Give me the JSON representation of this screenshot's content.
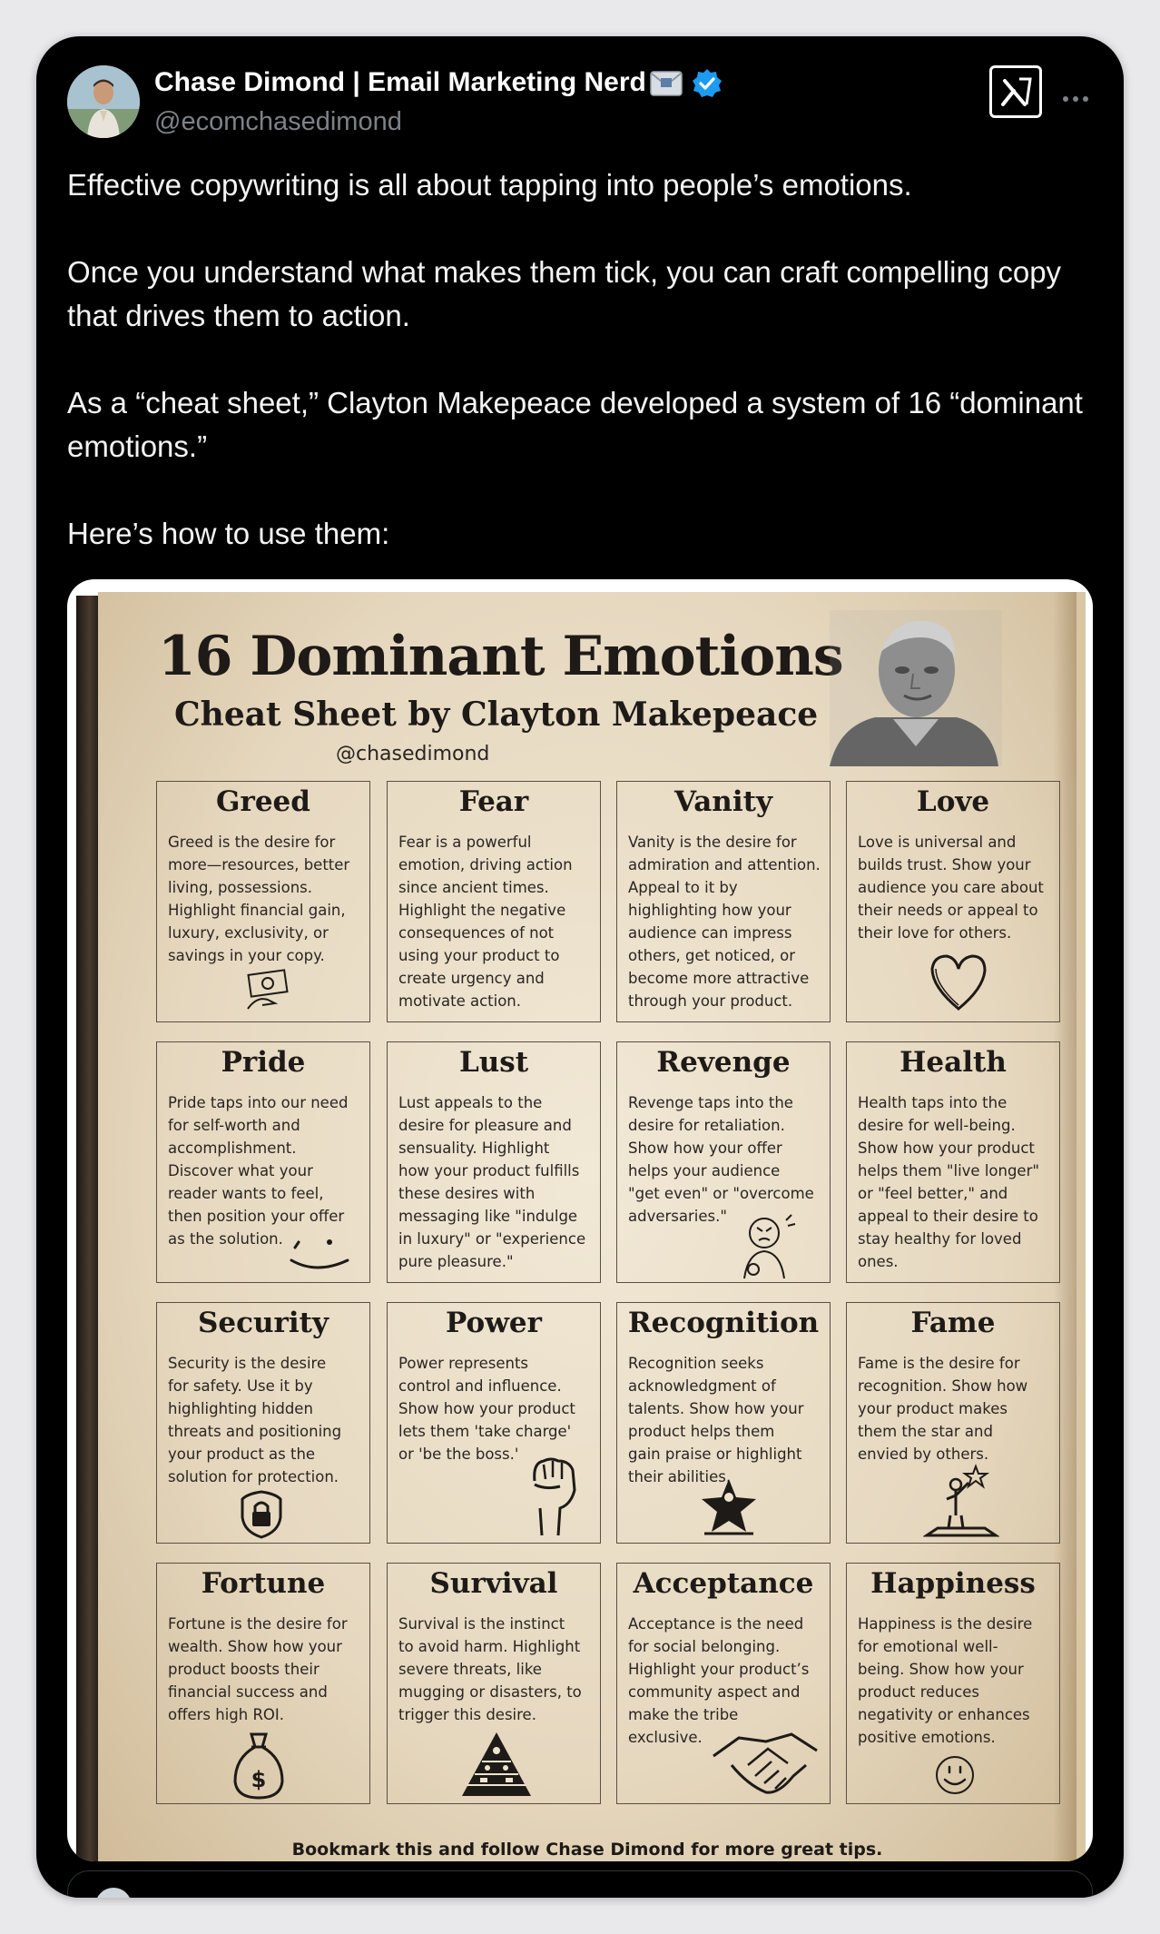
{
  "author": {
    "name": "Chase Dimond | Email Marketing Nerd",
    "handle": "@ecomchasedimond"
  },
  "tweet": {
    "paragraphs": [
      "Effective copywriting is all about tapping into people’s emotions.",
      "Once you understand what makes them tick, you can craft compelling copy that drives them to action.",
      "As a “cheat sheet,” Clayton Makepeace developed a system of 16 “dominant emotions.”",
      "Here’s how to use them:"
    ]
  },
  "infographic": {
    "title": "16 Dominant Emotions",
    "subtitle": "Cheat Sheet by Clayton Makepeace",
    "handle": "@chasedimond",
    "footer": "Bookmark this and follow Chase Dimond for more great tips.",
    "emotions": [
      {
        "title": "Greed",
        "icon": "money-hand-icon",
        "desc": "Greed is the desire for\nmore—resources, better\nliving, possessions.\nHighlight financial gain,\nluxury, exclusivity, or\nsavings in your copy."
      },
      {
        "title": "Fear",
        "icon": "",
        "desc": "Fear is a powerful\nemotion, driving action\nsince ancient times.\nHighlight the negative\nconsequences of not\nusing your product to\ncreate urgency and\nmotivate action."
      },
      {
        "title": "Vanity",
        "icon": "",
        "desc": "Vanity is the desire for\nadmiration and attention.\nAppeal to it by\nhighlighting how your\naudience can impress\nothers, get noticed, or\nbecome more attractive\nthrough your product."
      },
      {
        "title": "Love",
        "icon": "heart-icon",
        "desc": "Love is universal and\nbuilds trust. Show your\naudience you care about\ntheir needs or appeal to\ntheir love for others."
      },
      {
        "title": "Pride",
        "icon": "smile-icon",
        "desc": "Pride taps into our need\nfor self-worth and\naccomplishment.\nDiscover what your\nreader wants to feel,\nthen position your offer\nas the solution."
      },
      {
        "title": "Lust",
        "icon": "",
        "desc": "Lust appeals to the\ndesire for pleasure and\nsensuality. Highlight\nhow your product fulfills\nthese desires with\nmessaging like \"indulge\nin luxury\" or \"experience\npure pleasure.\""
      },
      {
        "title": "Revenge",
        "icon": "angry-person-icon",
        "desc": "Revenge taps into the\ndesire for retaliation.\nShow how your offer\nhelps your audience\n\"get even\" or \"overcome\nadversaries.\""
      },
      {
        "title": "Health",
        "icon": "",
        "desc": "Health taps into the\ndesire for well-being.\nShow how your product\nhelps them \"live longer\"\nor \"feel better,\" and\nappeal to their desire to\nstay healthy for loved\nones."
      },
      {
        "title": "Security",
        "icon": "lock-shield-icon",
        "desc": "Security is the desire\nfor safety. Use it by\nhighlighting hidden\nthreats and positioning\nyour product as the\nsolution for protection."
      },
      {
        "title": "Power",
        "icon": "raised-fist-icon",
        "desc": "Power represents\ncontrol and influence.\nShow how your product\nlets them 'take charge'\nor 'be the boss.'"
      },
      {
        "title": "Recognition",
        "icon": "star-person-icon",
        "desc": "Recognition seeks\nacknowledgment of\ntalents. Show how your\nproduct helps them\ngain praise or highlight\ntheir abilities."
      },
      {
        "title": "Fame",
        "icon": "podium-star-icon",
        "desc": "Fame is the desire for\nrecognition. Show how\nyour product makes\nthem the star and\nenvied by others."
      },
      {
        "title": "Fortune",
        "icon": "money-bag-icon",
        "desc": "Fortune is the desire for\nwealth. Show how your\nproduct boosts their\nfinancial success and\noffers high ROI."
      },
      {
        "title": "Survival",
        "icon": "pyramid-icon",
        "desc": "Survival is the instinct\nto avoid harm. Highlight\nsevere threats, like\nmugging or disasters, to\ntrigger this desire."
      },
      {
        "title": "Acceptance",
        "icon": "handshake-icon",
        "desc": "Acceptance is the need\nfor social belonging.\nHighlight your product’s\ncommunity aspect and\nmake the tribe\nexclusive."
      },
      {
        "title": "Happiness",
        "icon": "smiley-face-icon",
        "desc": "Happiness is the desire\nfor emotional well-\nbeing. Show how your\nproduct reduces\nnegativity or enhances\npositive emotions."
      }
    ]
  },
  "colors": {
    "card_bg": "#000000",
    "text": "#f4f4f4",
    "handle": "#7c8288",
    "verified": "#1d9bf0",
    "paper": "#ede3cf",
    "ink": "#1e1a17"
  }
}
